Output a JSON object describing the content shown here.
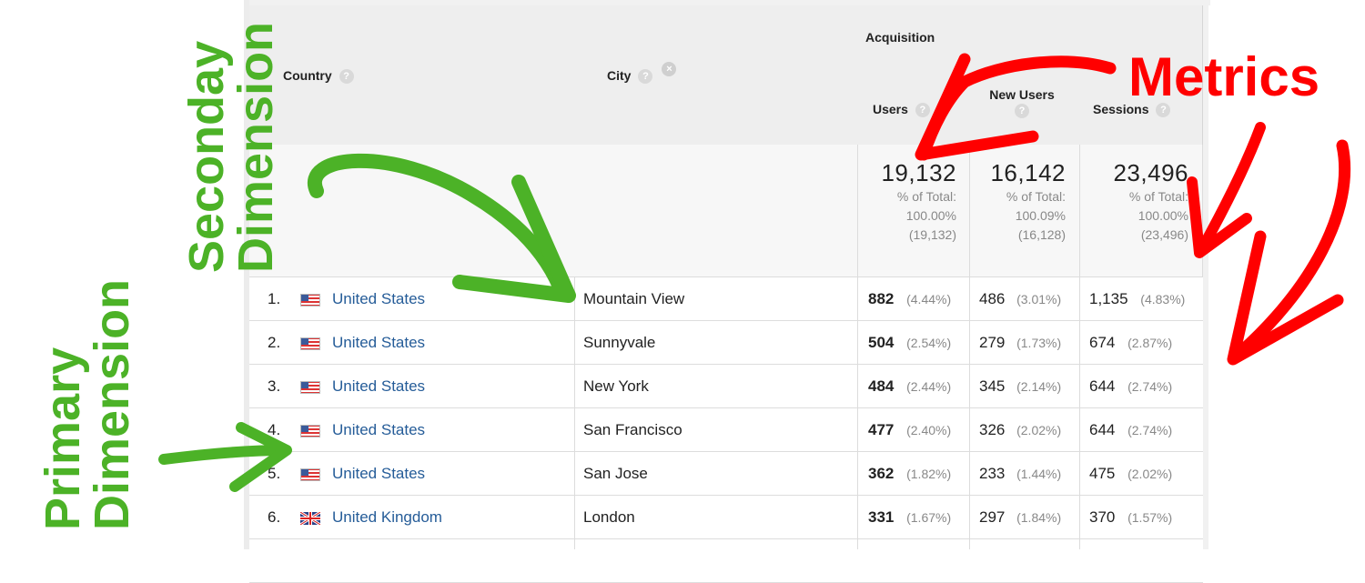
{
  "columns": {
    "country": "Country",
    "city": "City",
    "group": "Acquisition",
    "users": "Users",
    "new_users": "New Users",
    "sessions": "Sessions"
  },
  "help_glyph": "?",
  "remove_glyph": "×",
  "totals": {
    "users": {
      "value": "19,132",
      "label": "% of Total:",
      "pct": "100.00%",
      "base": "(19,132)"
    },
    "new_users": {
      "value": "16,142",
      "label": "% of Total:",
      "pct": "100.09%",
      "base": "(16,128)"
    },
    "sessions": {
      "value": "23,496",
      "label": "% of Total:",
      "pct": "100.00%",
      "base": "(23,496)"
    }
  },
  "rows": [
    {
      "num": "1.",
      "flag": "us-flag-icon",
      "country": "United States",
      "city": "Mountain View",
      "users": "882",
      "users_pct": "(4.44%)",
      "new_users": "486",
      "new_users_pct": "(3.01%)",
      "sessions": "1,135",
      "sessions_pct": "(4.83%)"
    },
    {
      "num": "2.",
      "flag": "us-flag-icon",
      "country": "United States",
      "city": "Sunnyvale",
      "users": "504",
      "users_pct": "(2.54%)",
      "new_users": "279",
      "new_users_pct": "(1.73%)",
      "sessions": "674",
      "sessions_pct": "(2.87%)"
    },
    {
      "num": "3.",
      "flag": "us-flag-icon",
      "country": "United States",
      "city": "New York",
      "users": "484",
      "users_pct": "(2.44%)",
      "new_users": "345",
      "new_users_pct": "(2.14%)",
      "sessions": "644",
      "sessions_pct": "(2.74%)"
    },
    {
      "num": "4.",
      "flag": "us-flag-icon",
      "country": "United States",
      "city": "San Francisco",
      "users": "477",
      "users_pct": "(2.40%)",
      "new_users": "326",
      "new_users_pct": "(2.02%)",
      "sessions": "644",
      "sessions_pct": "(2.74%)"
    },
    {
      "num": "5.",
      "flag": "us-flag-icon",
      "country": "United States",
      "city": "San Jose",
      "users": "362",
      "users_pct": "(1.82%)",
      "new_users": "233",
      "new_users_pct": "(1.44%)",
      "sessions": "475",
      "sessions_pct": "(2.02%)"
    },
    {
      "num": "6.",
      "flag": "uk-flag-icon",
      "country": "United Kingdom",
      "city": "London",
      "users": "331",
      "users_pct": "(1.67%)",
      "new_users": "297",
      "new_users_pct": "(1.84%)",
      "sessions": "370",
      "sessions_pct": "(1.57%)"
    }
  ],
  "annotations": {
    "metrics": "Metrics",
    "secondary_line1": "Seconday",
    "secondary_line2": "Dimension",
    "primary_line1": "Primary",
    "primary_line2": "Dimension"
  },
  "colors": {
    "annotation_green": "#4cb227",
    "annotation_red": "#ff0000",
    "link_blue": "#255c98"
  }
}
